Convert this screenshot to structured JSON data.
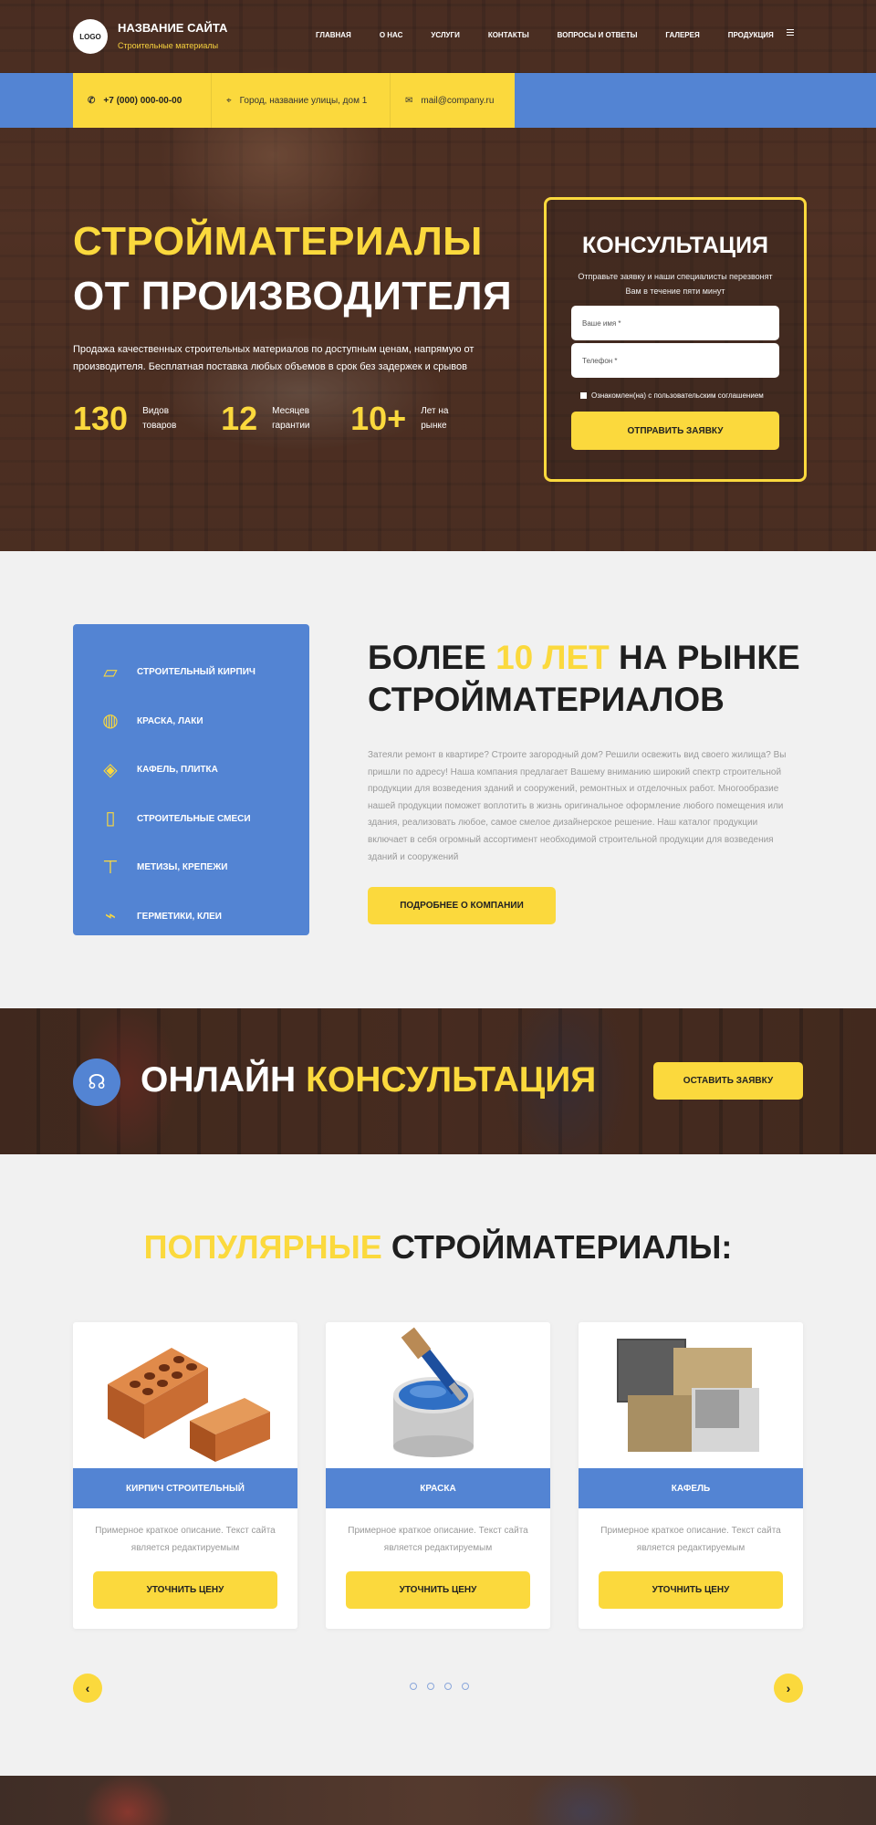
{
  "header": {
    "logo_text": "LOGO",
    "site_name": "НАЗВАНИЕ САЙТА",
    "site_sub": "Строительные материалы",
    "menu": [
      "ГЛАВНАЯ",
      "О НАС",
      "УСЛУГИ",
      "КОНТАКТЫ",
      "ВОПРОСЫ И ОТВЕТЫ",
      "ГАЛЕРЕЯ",
      "ПРОДУКЦИЯ"
    ],
    "menu_icon": "hamburger-icon"
  },
  "infobar": {
    "phone": "+7 (000) 000-00-00",
    "address": "Город, название улицы, дом 1",
    "email": "mail@company.ru",
    "socials": [
      "vk-icon",
      "twitter-icon",
      "odnoklassniki-icon",
      "youtube-icon",
      "telegram-icon"
    ]
  },
  "hero": {
    "title_line1": "СТРОЙМАТЕРИАЛЫ",
    "title_line2": "ОТ ПРОИЗВОДИТЕЛЯ",
    "description": "Продажа качественных строительных материалов по доступным ценам, напрямую от производителя. Бесплатная поставка любых объемов в срок без задержек и срывов",
    "stats": [
      {
        "value": "130",
        "label": "Видов товаров"
      },
      {
        "value": "12",
        "label": "Месяцев гарантии"
      },
      {
        "value": "10+",
        "label": "Лет на рынке"
      }
    ]
  },
  "form": {
    "title": "КОНСУЛЬТАЦИЯ",
    "subtitle": "Отправьте заявку и наши специалисты перезвонят Вам в течение пяти минут",
    "name_placeholder": "Ваше имя *",
    "phone_placeholder": "Телефон *",
    "agree": "Ознакомлен(на) с пользовательским соглашением",
    "submit": "ОТПРАВИТЬ ЗАЯВКУ"
  },
  "categories": [
    {
      "label": "СТРОИТЕЛЬНЫЙ КИРПИЧ",
      "icon": "brick-icon"
    },
    {
      "label": "КРАСКА, ЛАКИ",
      "icon": "paint-can-icon"
    },
    {
      "label": "КАФЕЛЬ, ПЛИТКА",
      "icon": "tiles-icon"
    },
    {
      "label": "СТРОИТЕЛЬНЫЕ СМЕСИ",
      "icon": "cement-bag-icon"
    },
    {
      "label": "МЕТИЗЫ, КРЕПЕЖИ",
      "icon": "screws-icon"
    },
    {
      "label": "ГЕРМЕТИКИ, КЛЕИ",
      "icon": "sealant-gun-icon"
    }
  ],
  "about": {
    "title_part1": "БОЛЕЕ ",
    "title_highlight": "10 ЛЕТ",
    "title_part2": " НА РЫНКЕ",
    "title_line2": "СТРОЙМАТЕРИАЛОВ",
    "text": "Затеяли ремонт в квартире? Строите загородный дом? Решили освежить вид своего жилища? Вы пришли по адресу! Наша компания предлагает Вашему вниманию широкий спектр строительной продукции для возведения зданий и сооружений, ремонтных и отделочных работ. Многообразие нашей продукции поможет воплотить в жизнь оригинальное оформление любого помещения или здания, реализовать любое, самое смелое дизайнерское решение. Наш каталог продукции включает в себя огромный ассортимент необходимой строительной продукции для возведения зданий и сооружений",
    "button": "ПОДРОБНЕЕ О КОМПАНИИ"
  },
  "banner": {
    "icon": "operator-icon",
    "title_part1": "ОНЛАЙН ",
    "title_highlight": "КОНСУЛЬТАЦИЯ",
    "button": "ОСТАВИТЬ ЗАЯВКУ"
  },
  "popular": {
    "title_highlight": "ПОПУЛЯРНЫЕ",
    "title_rest": " СТРОЙМАТЕРИАЛЫ:",
    "products": [
      {
        "name": "КИРПИЧ СТРОИТЕЛЬНЫЙ",
        "desc": "Примерное краткое описание. Текст сайта является редактируемым",
        "button": "УТОЧНИТЬ ЦЕНУ",
        "image": "bricks-image"
      },
      {
        "name": "КРАСКА",
        "desc": "Примерное краткое описание. Текст сайта является редактируемым",
        "button": "УТОЧНИТЬ ЦЕНУ",
        "image": "paint-can-image"
      },
      {
        "name": "КАФЕЛЬ",
        "desc": "Примерное краткое описание. Текст сайта является редактируемым",
        "button": "УТОЧНИТЬ ЦЕНУ",
        "image": "tile-samples-image"
      }
    ],
    "prev_icon": "chevron-left-icon",
    "next_icon": "chevron-right-icon",
    "dots_count": 4
  },
  "colors": {
    "accent": "#fbd93d",
    "primary": "#5384d3"
  }
}
